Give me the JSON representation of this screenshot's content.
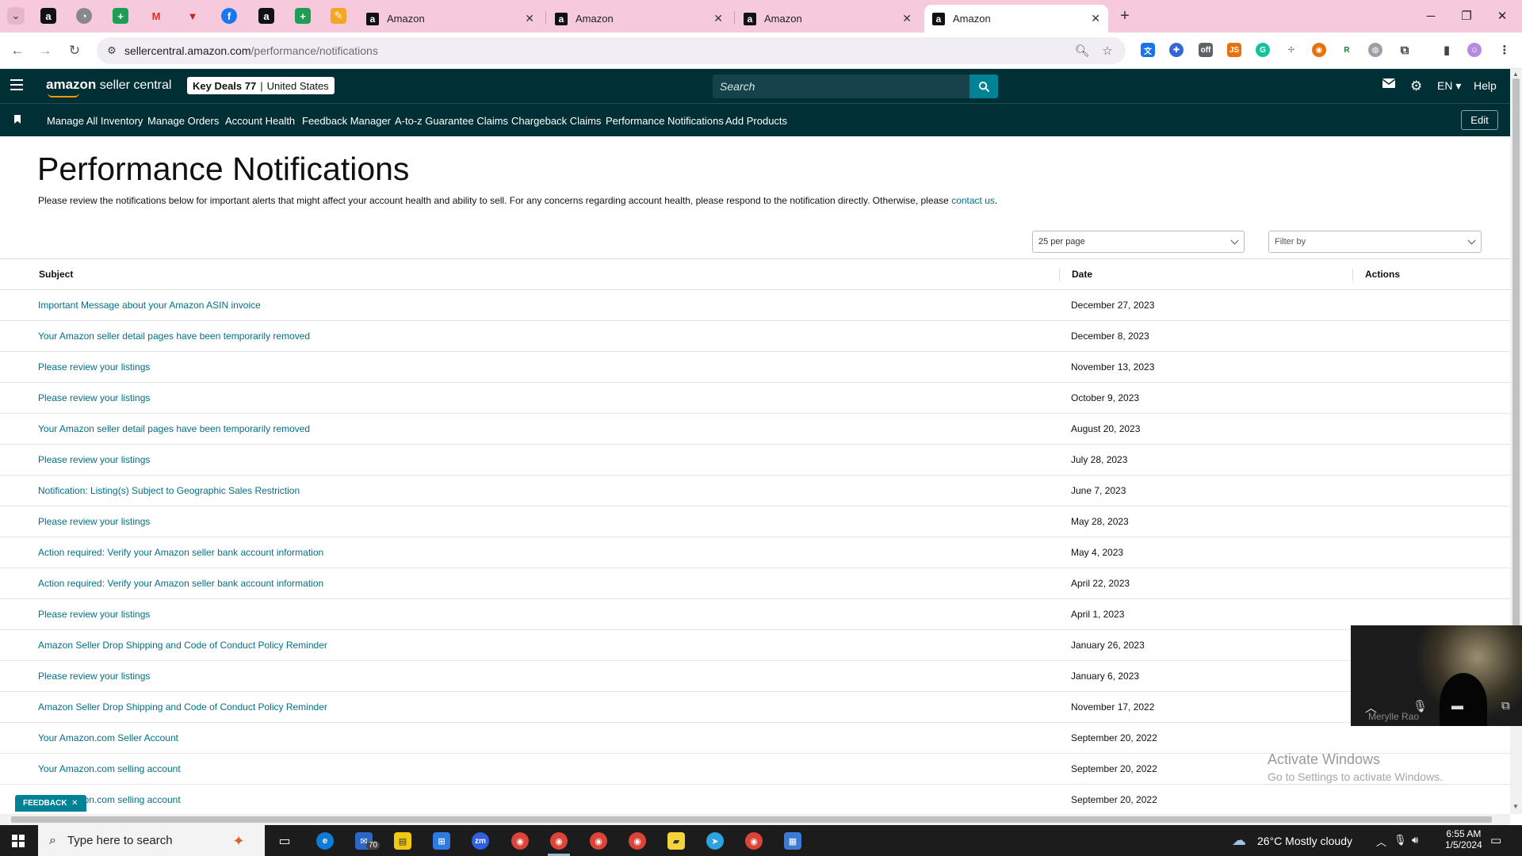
{
  "browser": {
    "tabs": [
      {
        "title": "Amazon",
        "active": false
      },
      {
        "title": "Amazon",
        "active": false
      },
      {
        "title": "Amazon",
        "active": false
      },
      {
        "title": "Amazon",
        "active": true
      }
    ],
    "url_host": "sellercentral.amazon.com",
    "url_path": "/performance/notifications"
  },
  "header": {
    "logo_bold": "amazon",
    "logo_rest": " seller central",
    "store_name": "Key Deals 77",
    "store_region": "United States",
    "search_placeholder": "Search",
    "language": "EN",
    "help": "Help"
  },
  "nav": {
    "links": [
      "Manage All Inventory",
      "Manage Orders",
      "Account Health",
      "Feedback Manager",
      "A-to-z Guarantee Claims",
      "Chargeback Claims",
      "Performance Notifications",
      "Add Products"
    ],
    "edit_label": "Edit"
  },
  "page": {
    "title": "Performance Notifications",
    "intro": "Please review the notifications below for important alerts that might affect your account health and ability to sell. For any concerns regarding account health, please respond to the notification directly. Otherwise, please ",
    "intro_link": "contact us",
    "intro_end": ".",
    "per_page": "25 per page",
    "filter_placeholder": "Filter by"
  },
  "table": {
    "headers": {
      "subject": "Subject",
      "date": "Date",
      "actions": "Actions"
    },
    "rows": [
      {
        "subject": "Important Message about your Amazon ASIN invoice",
        "date": "December 27, 2023"
      },
      {
        "subject": "Your Amazon seller detail pages have been temporarily removed",
        "date": "December 8, 2023"
      },
      {
        "subject": "Please review your listings",
        "date": "November 13, 2023"
      },
      {
        "subject": "Please review your listings",
        "date": "October 9, 2023"
      },
      {
        "subject": "Your Amazon seller detail pages have been temporarily removed",
        "date": "August 20, 2023"
      },
      {
        "subject": "Please review your listings",
        "date": "July 28, 2023"
      },
      {
        "subject": "Notification: Listing(s) Subject to Geographic Sales Restriction",
        "date": "June 7, 2023"
      },
      {
        "subject": "Please review your listings",
        "date": "May 28, 2023"
      },
      {
        "subject": "Action required: Verify your Amazon seller bank account information",
        "date": "May 4, 2023"
      },
      {
        "subject": "Action required: Verify your Amazon seller bank account information",
        "date": "April 22, 2023"
      },
      {
        "subject": "Please review your listings",
        "date": "April 1, 2023"
      },
      {
        "subject": "Amazon Seller Drop Shipping and Code of Conduct Policy Reminder",
        "date": "January 26, 2023"
      },
      {
        "subject": "Please review your listings",
        "date": "January 6, 2023"
      },
      {
        "subject": "Amazon Seller Drop Shipping and Code of Conduct Policy Reminder",
        "date": "November 17, 2022"
      },
      {
        "subject": "Your Amazon.com Seller Account",
        "date": "September 20, 2022"
      },
      {
        "subject": "Your Amazon.com selling account",
        "date": "September 20, 2022"
      },
      {
        "subject": "Your Amazon.com selling account",
        "date": "September 20, 2022"
      }
    ]
  },
  "feedback_label": "FEEDBACK",
  "video": {
    "participant": "Merylle Rao"
  },
  "watermark": {
    "line1": "Activate Windows",
    "line2": "Go to Settings to activate Windows."
  },
  "taskbar": {
    "search_placeholder": "Type here to search",
    "mail_badge": "70",
    "weather": "26°C  Mostly cloudy",
    "time": "6:55 AM",
    "date": "1/5/2024"
  },
  "colors": {
    "header_bg": "#002f36",
    "link": "#007185",
    "search_btn": "#008296",
    "tab_strip": "#f6c9dc"
  }
}
